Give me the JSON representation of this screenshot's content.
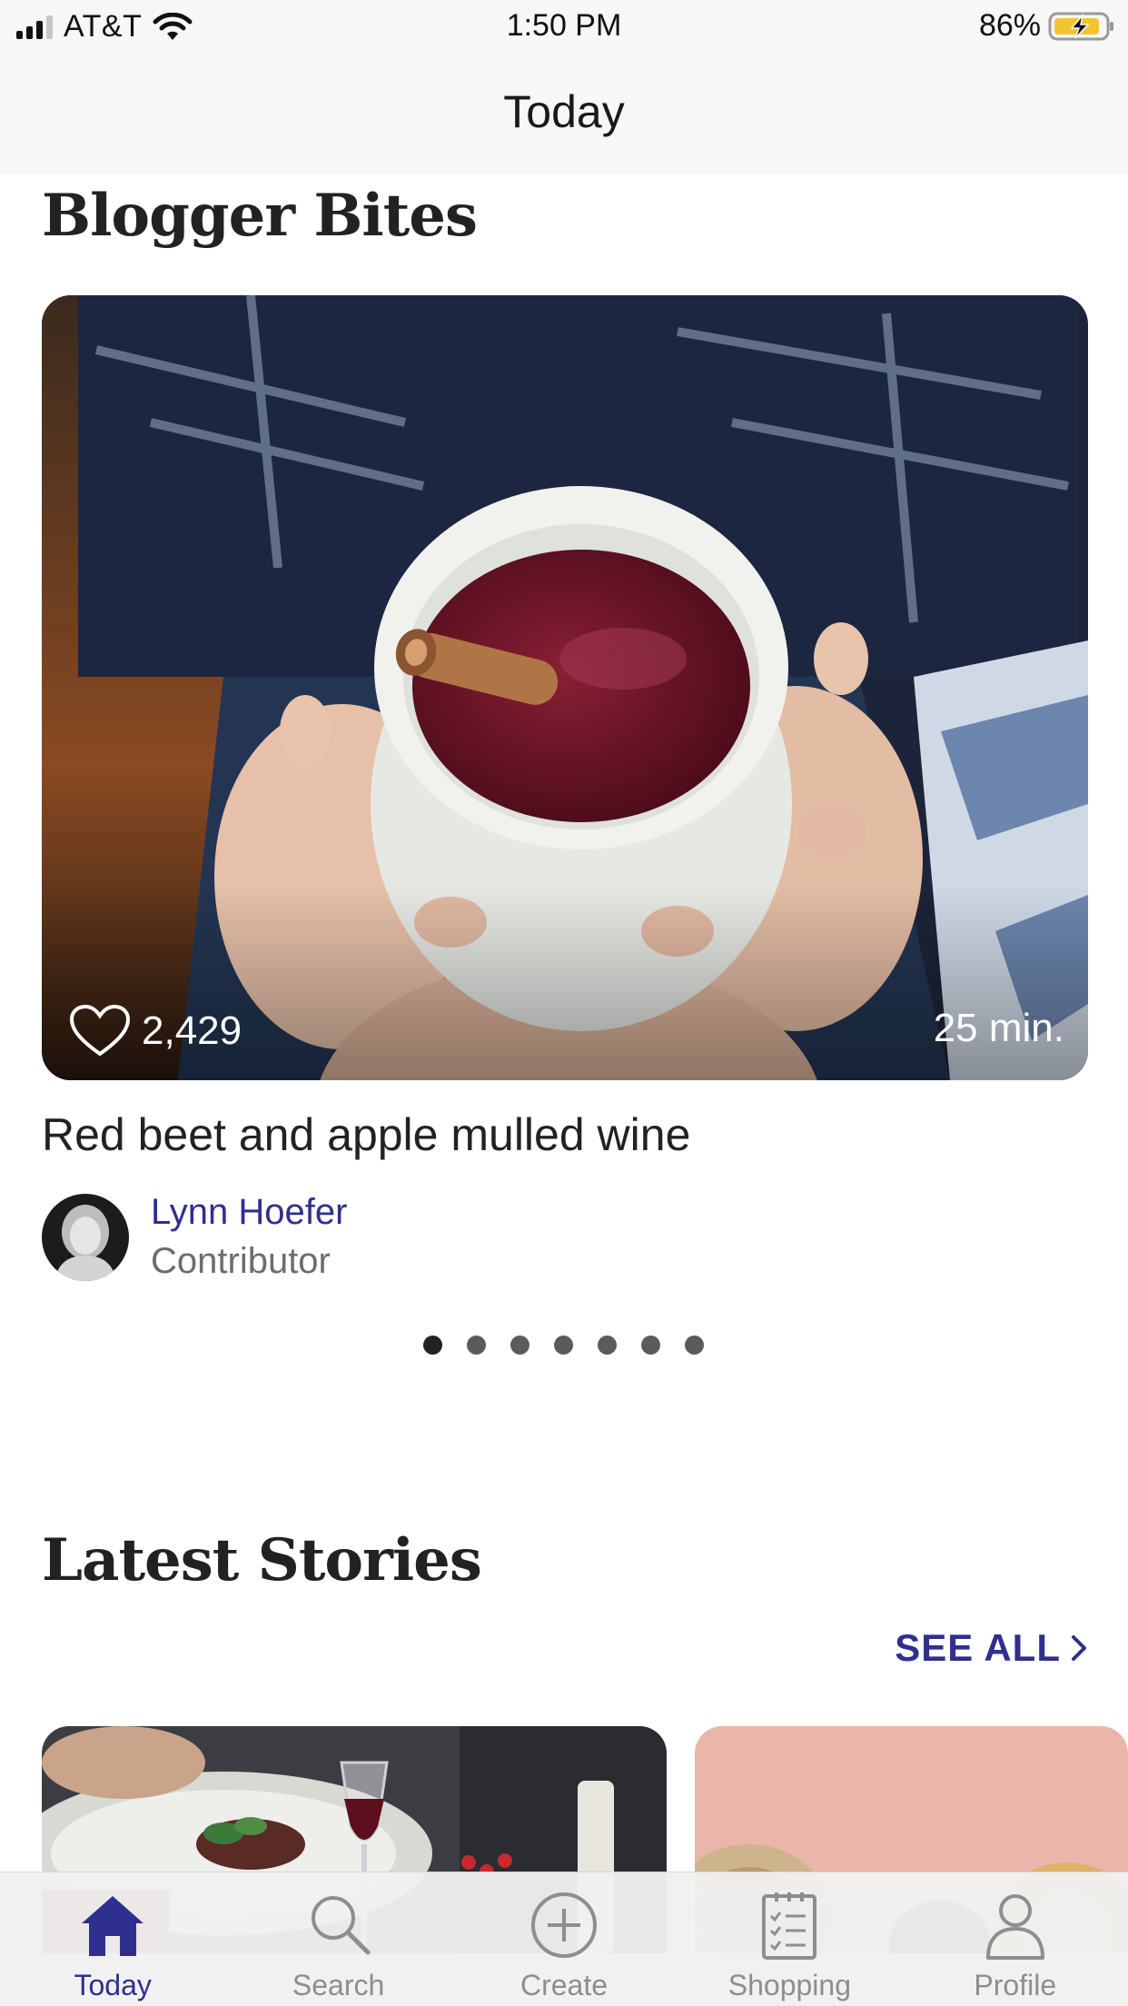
{
  "status_bar": {
    "carrier": "AT&T",
    "time": "1:50 PM",
    "battery_percent": "86%"
  },
  "header": {
    "title": "Today"
  },
  "blogger_bites": {
    "heading": "Blogger Bites",
    "card": {
      "likes": "2,429",
      "duration": "25 min.",
      "title": "Red beet and apple mulled wine",
      "author_name": "Lynn Hoefer",
      "author_role": "Contributor"
    },
    "carousel": {
      "page_count": 7,
      "active_index": 0
    }
  },
  "latest_stories": {
    "heading": "Latest Stories",
    "see_all_label": "SEE ALL"
  },
  "tab_bar": {
    "items": [
      {
        "label": "Today",
        "icon": "home-icon",
        "active": true
      },
      {
        "label": "Search",
        "icon": "search-icon",
        "active": false
      },
      {
        "label": "Create",
        "icon": "plus-circle-icon",
        "active": false
      },
      {
        "label": "Shopping",
        "icon": "checklist-icon",
        "active": false
      },
      {
        "label": "Profile",
        "icon": "person-icon",
        "active": false
      }
    ]
  },
  "colors": {
    "accent": "#2f2f8f",
    "tab_inactive": "#8e8e8e"
  }
}
